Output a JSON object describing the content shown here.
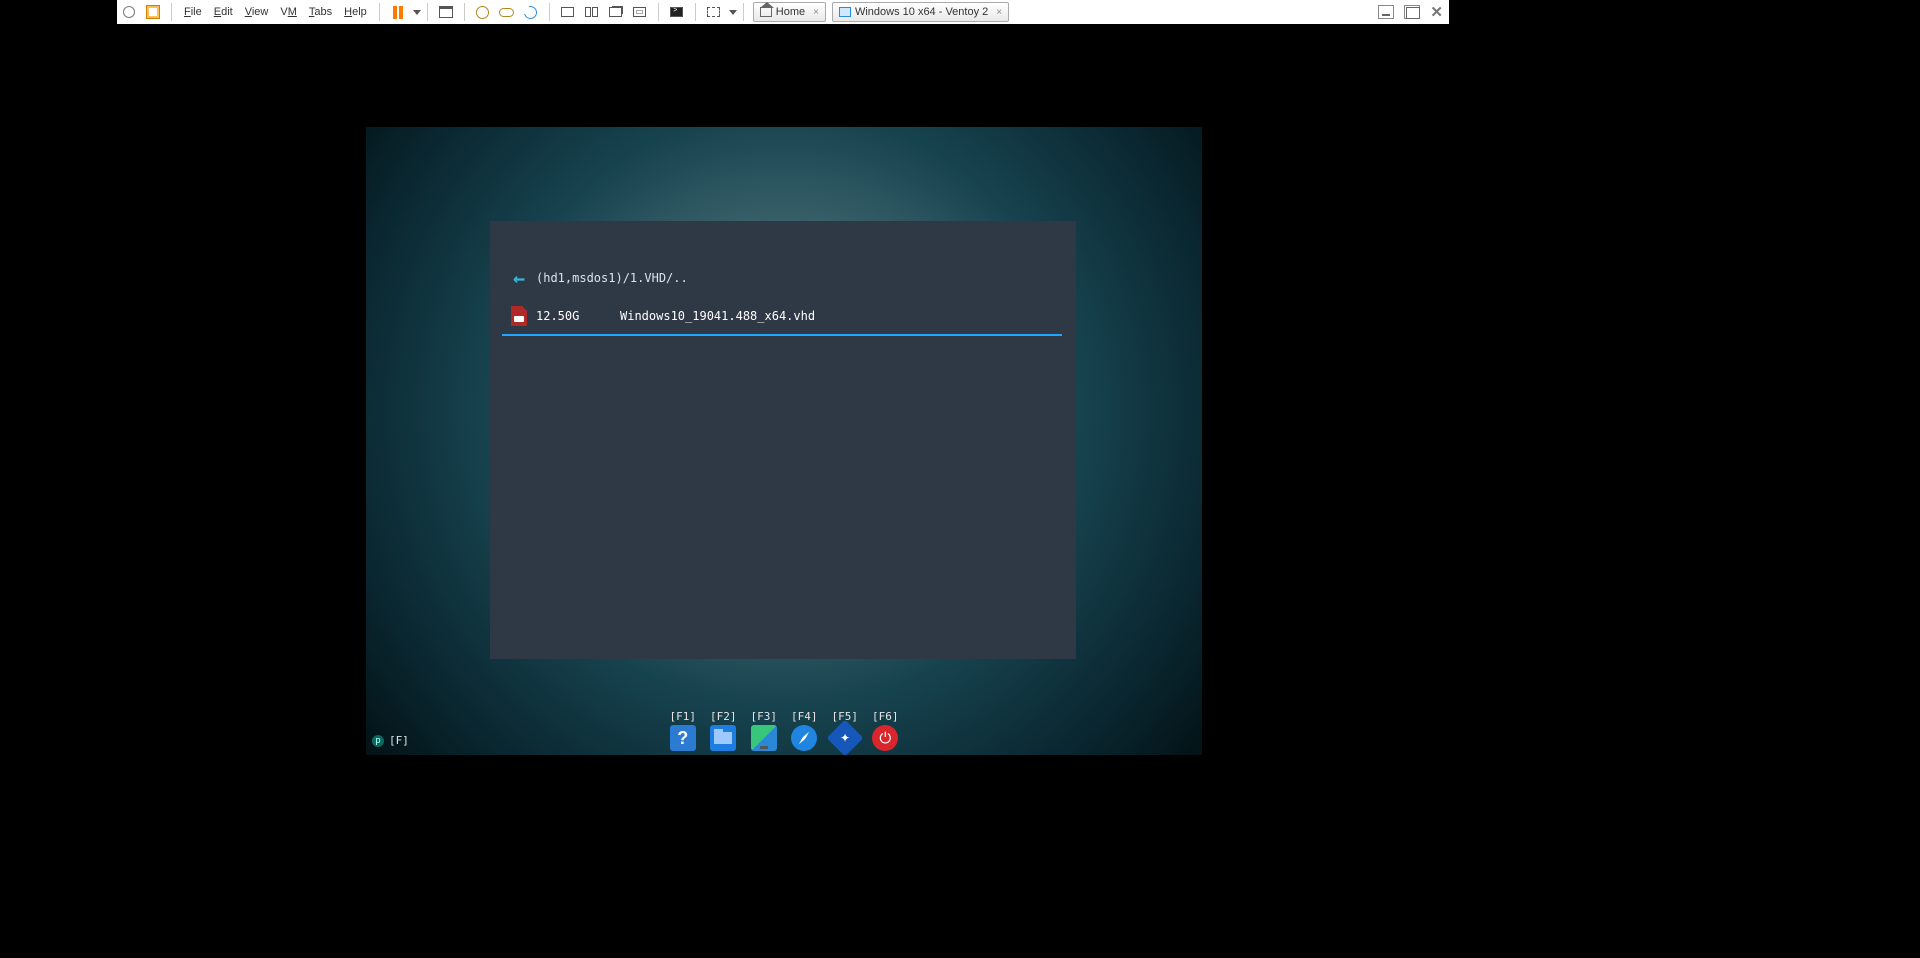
{
  "vmw": {
    "menus": {
      "file": "File",
      "edit": "Edit",
      "view": "View",
      "vm": "VM",
      "tabs": "Tabs",
      "help": "Help"
    },
    "home_tab": "Home",
    "vm_tab": "Windows 10 x64 - Ventoy 2"
  },
  "ventoy": {
    "path": "(hd1,msdos1)/1.VHD/..",
    "entry": {
      "size": "12.50G",
      "name": "Windows10_19041.488_x64.vhd"
    },
    "keys": {
      "f1": "[F1]",
      "f2": "[F2]",
      "f3": "[F3]",
      "f4": "[F4]",
      "f5": "[F5]",
      "f6": "[F6]"
    },
    "corner": "[F]"
  }
}
